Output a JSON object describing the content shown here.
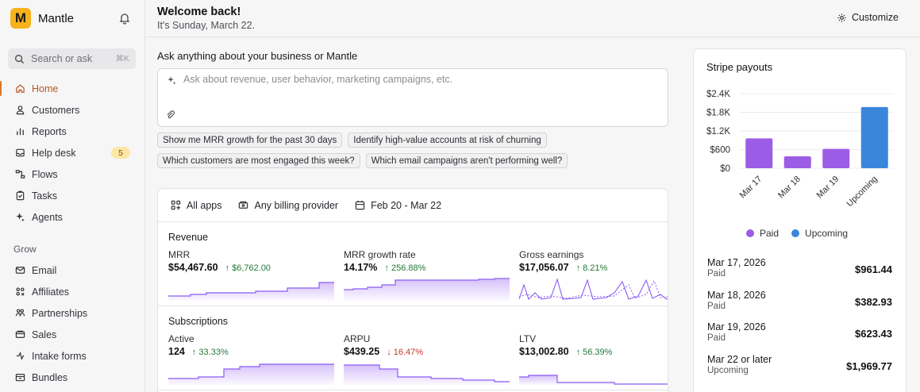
{
  "app": {
    "name": "Mantle",
    "logo_letter": "M",
    "logo_color": "#f7b21c",
    "accent": "#d9772e"
  },
  "search": {
    "placeholder": "Search or ask",
    "shortcut": "⌘K"
  },
  "nav": [
    {
      "label": "Home",
      "icon": "home-icon",
      "active": true
    },
    {
      "label": "Customers",
      "icon": "user-icon"
    },
    {
      "label": "Reports",
      "icon": "bar-chart-icon"
    },
    {
      "label": "Help desk",
      "icon": "inbox-icon",
      "badge": "5"
    },
    {
      "label": "Flows",
      "icon": "flow-icon"
    },
    {
      "label": "Tasks",
      "icon": "clipboard-icon"
    },
    {
      "label": "Agents",
      "icon": "sparkle-icon"
    }
  ],
  "grow": {
    "label": "Grow",
    "items": [
      {
        "label": "Email",
        "icon": "mail-icon"
      },
      {
        "label": "Affiliates",
        "icon": "affiliates-icon"
      },
      {
        "label": "Partnerships",
        "icon": "partnership-icon"
      },
      {
        "label": "Sales",
        "icon": "sales-icon"
      },
      {
        "label": "Intake forms",
        "icon": "form-icon"
      },
      {
        "label": "Bundles",
        "icon": "bundle-icon"
      }
    ]
  },
  "header": {
    "title": "Welcome back!",
    "subtitle": "It's Sunday, March 22.",
    "customize_label": "Customize"
  },
  "ask": {
    "title": "Ask anything about your business or Mantle",
    "placeholder": "Ask about revenue, user behavior, marketing campaigns, etc.",
    "suggestions": [
      "Show me MRR growth for the past 30 days",
      "Identify high-value accounts at risk of churning",
      "Which customers are most engaged this week?",
      "Which email campaigns aren't performing well?"
    ]
  },
  "filters": {
    "apps": "All apps",
    "billing": "Any billing provider",
    "dates": "Feb 20 - Mar 22"
  },
  "revenue": {
    "title": "Revenue",
    "metrics": [
      {
        "name": "MRR",
        "value": "$54,467.60",
        "change": "↑ $6,762.00",
        "direction": "up"
      },
      {
        "name": "MRR growth rate",
        "value": "14.17%",
        "change": "↑ 256.88%",
        "direction": "up"
      },
      {
        "name": "Gross earnings",
        "value": "$17,056.07",
        "change": "↑ 8.21%",
        "direction": "up"
      }
    ]
  },
  "subscriptions": {
    "title": "Subscriptions",
    "metrics": [
      {
        "name": "Active",
        "value": "124",
        "change": "↑ 33.33%",
        "direction": "up"
      },
      {
        "name": "ARPU",
        "value": "$439.25",
        "change": "↓ 16.47%",
        "direction": "down"
      },
      {
        "name": "LTV",
        "value": "$13,002.80",
        "change": "↑ 56.39%",
        "direction": "up"
      }
    ]
  },
  "stripe": {
    "title": "Stripe payouts",
    "legend": {
      "paid": "Paid",
      "upcoming": "Upcoming",
      "paid_color": "#9b5de5",
      "upcoming_color": "#3a86dc"
    },
    "payouts": [
      {
        "date": "Mar 17, 2026",
        "status": "Paid",
        "amount": "$961.44"
      },
      {
        "date": "Mar 18, 2026",
        "status": "Paid",
        "amount": "$382.93"
      },
      {
        "date": "Mar 19, 2026",
        "status": "Paid",
        "amount": "$623.43"
      },
      {
        "date": "Mar 22 or later",
        "status": "Upcoming",
        "amount": "$1,969.77"
      }
    ]
  },
  "chart_data": {
    "type": "bar",
    "categories": [
      "Mar 17",
      "Mar 18",
      "Mar 19",
      "Upcoming"
    ],
    "values": [
      961.44,
      382.93,
      623.43,
      1969.77
    ],
    "colors": [
      "#9b5de5",
      "#9b5de5",
      "#9b5de5",
      "#3a86dc"
    ],
    "yticks": [
      "$2.4K",
      "$1.8K",
      "$1.2K",
      "$600",
      "$0"
    ],
    "ytick_values": [
      2400,
      1800,
      1200,
      600,
      0
    ],
    "ylim": [
      0,
      2400
    ],
    "grid": true,
    "legend": "bottom"
  }
}
